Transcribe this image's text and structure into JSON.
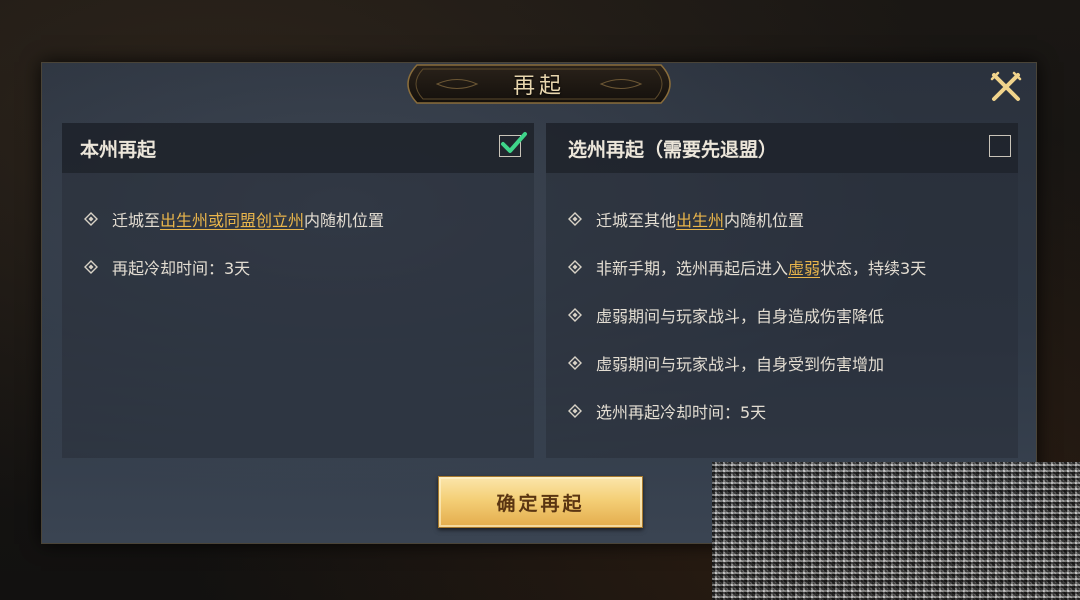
{
  "dialog": {
    "title": "再起",
    "close_icon": "close-x-icon",
    "confirm_label": "确定再起"
  },
  "left_panel": {
    "title": "本州再起",
    "checked": true,
    "bullets": [
      {
        "prefix": "迁城至",
        "highlight": "出生州或同盟创立州",
        "suffix": "内随机位置"
      },
      {
        "text": "再起冷却时间：3天"
      }
    ]
  },
  "right_panel": {
    "title": "选州再起（需要先退盟）",
    "checked": false,
    "bullets": [
      {
        "prefix": "迁城至其他",
        "highlight": "出生州",
        "suffix": "内随机位置"
      },
      {
        "prefix": "非新手期，选州再起后进入",
        "highlight": "虚弱",
        "suffix": "状态，持续3天"
      },
      {
        "text": "虚弱期间与玩家战斗，自身造成伤害降低"
      },
      {
        "text": "虚弱期间与玩家战斗，自身受到伤害增加"
      },
      {
        "text": "选州再起冷却时间：5天"
      }
    ]
  },
  "colors": {
    "highlight": "#e9b54b",
    "check": "#3fd58a",
    "button": "#f4cf77"
  }
}
